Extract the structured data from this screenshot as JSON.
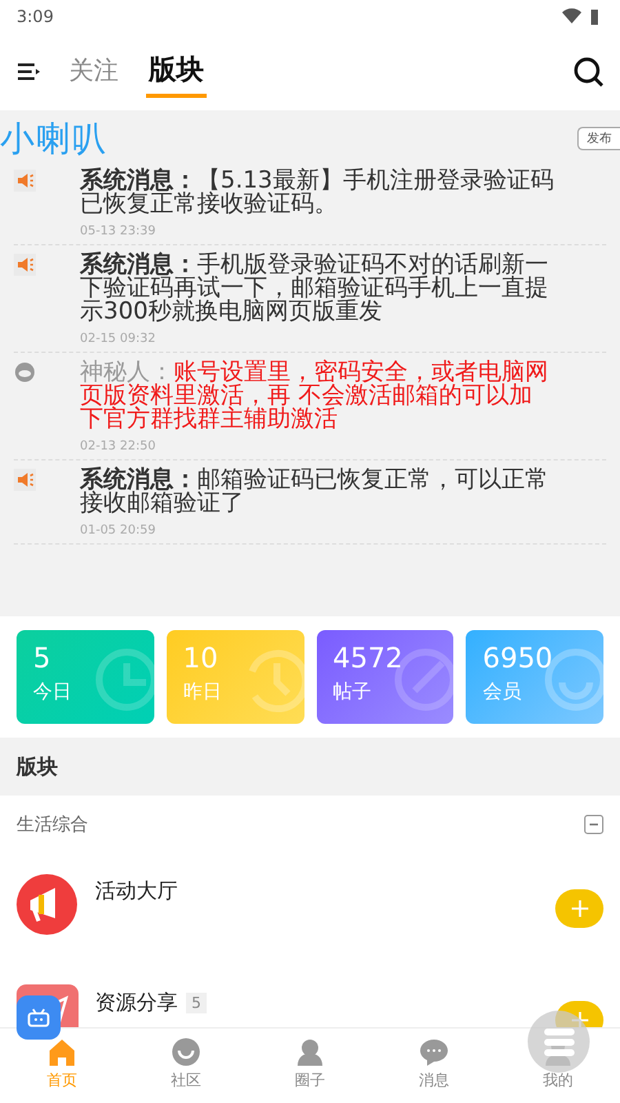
{
  "status_bar": {
    "time": "3:09"
  },
  "header": {
    "tabs": [
      {
        "label": "关注",
        "selected": false
      },
      {
        "label": "版块",
        "selected": true
      }
    ]
  },
  "notice_board": {
    "title": "小喇叭",
    "publish_button": "发布",
    "messages": [
      {
        "kind": "system",
        "sender": "系统消息：",
        "text": "【5.13最新】手机注册登录验证码已恢复正常接收验证码。",
        "time": "05-13 23:39"
      },
      {
        "kind": "system",
        "sender": "系统消息：",
        "text": "手机版登录验证码不对的话刷新一下验证码再试一下，邮箱验证码手机上一直提示300秒就换电脑网页版重发",
        "time": "02-15 09:32"
      },
      {
        "kind": "user",
        "sender": "神秘人：",
        "text": "账号设置里，密码安全，或者电脑网页版资料里激活，再 不会激活邮箱的可以加下官方群找群主辅助激活",
        "time": "02-13 22:50"
      },
      {
        "kind": "system",
        "sender": "系统消息：",
        "text": "邮箱验证码已恢复正常，可以正常接收邮箱验证了",
        "time": "01-05 20:59"
      }
    ]
  },
  "stats": [
    {
      "kind": "today",
      "value": "5",
      "label": "今日"
    },
    {
      "kind": "yesterday",
      "value": "10",
      "label": "昨日"
    },
    {
      "kind": "posts",
      "value": "4572",
      "label": "帖子"
    },
    {
      "kind": "members",
      "value": "6950",
      "label": "会员"
    }
  ],
  "section_title": "版块",
  "category": {
    "title": "生活综合",
    "expanded": true,
    "forums": [
      {
        "kind": "megaphone",
        "name": "活动大厅"
      },
      {
        "kind": "plane",
        "name": "资源分享",
        "count": "5"
      }
    ]
  },
  "bottom_nav": [
    {
      "kind": "home",
      "label": "首页",
      "selected": true
    },
    {
      "kind": "community",
      "label": "社区",
      "selected": false
    },
    {
      "kind": "circle",
      "label": "圈子",
      "selected": false
    },
    {
      "kind": "message",
      "label": "消息",
      "selected": false
    },
    {
      "kind": "me",
      "label": "我的",
      "selected": false
    }
  ]
}
